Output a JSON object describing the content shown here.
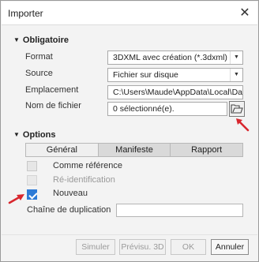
{
  "window": {
    "title": "Importer",
    "close_glyph": "✕"
  },
  "mandatory": {
    "heading": "Obligatoire",
    "format": {
      "label": "Format",
      "value": "3DXML avec création (*.3dxml)"
    },
    "source": {
      "label": "Source",
      "value": "Fichier sur disque"
    },
    "location": {
      "label": "Emplacement",
      "value": "C:\\Users\\Maude\\AppData\\Local\\Dassault"
    },
    "filename": {
      "label": "Nom de fichier",
      "value": "0 sélectionné(e)."
    }
  },
  "options": {
    "heading": "Options",
    "tabs": [
      {
        "label": "Général",
        "active": true
      },
      {
        "label": "Manifeste",
        "active": false
      },
      {
        "label": "Rapport",
        "active": false
      }
    ],
    "checkboxes": [
      {
        "label": "Comme référence",
        "checked": false,
        "enabled": true
      },
      {
        "label": "Ré-identification",
        "checked": false,
        "enabled": false
      },
      {
        "label": "Nouveau",
        "checked": true,
        "enabled": true
      }
    ],
    "dup_label": "Chaîne de duplication",
    "dup_value": ""
  },
  "footer": {
    "simulate": "Simuler",
    "preview3d": "Prévisu. 3D",
    "ok": "OK",
    "cancel": "Annuler"
  },
  "colors": {
    "accent": "#2d7bd6",
    "annotation_arrow": "#d8262d"
  },
  "icons": {
    "browse": "folder-open-icon",
    "dropdown": "chevron-down-icon",
    "close": "close-icon"
  }
}
